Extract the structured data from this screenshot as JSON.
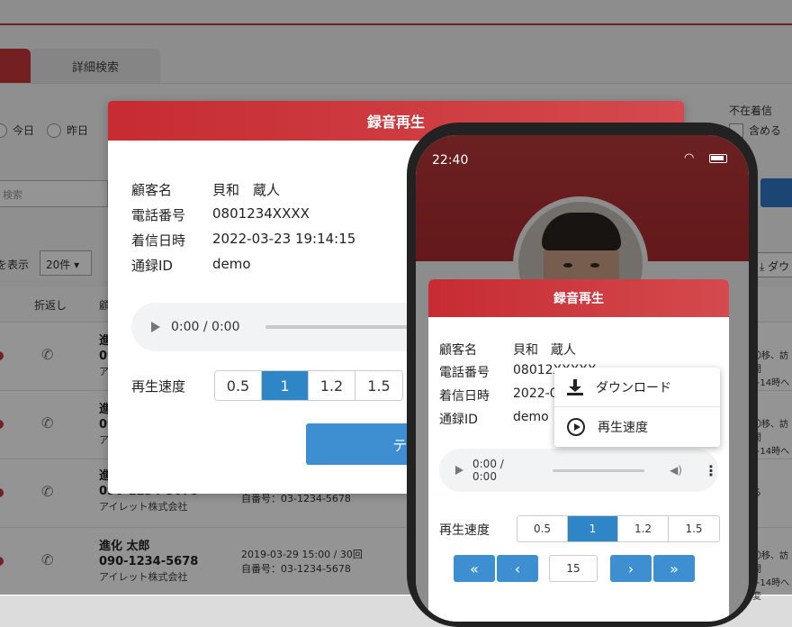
{
  "background": {
    "tab_advanced_search": "詳細検索",
    "radio_today": "今日",
    "radio_yesterday": "昨日",
    "keyword_placeholder": "検索",
    "missed_calls_label": "不在着信",
    "include_label": "含める",
    "show_label": "を表示",
    "count_select": "20件 ▾",
    "download_button": "⤓ ダウ",
    "col_callback": "折返し",
    "col_customer": "顧",
    "rows": [
      {
        "name": "進",
        "phone": "09",
        "company": "アイ",
        "info1": "",
        "info2": "",
        "side1": "〇移、訪問",
        "side2": "+14時へ変"
      },
      {
        "name": "進",
        "phone": "09",
        "company": "アイ",
        "info1": "",
        "info2": "",
        "side1": "〇移、訪問",
        "side2": "+14時へ変"
      },
      {
        "name": "進",
        "phone": "090-1234-5678",
        "company": "アイレット株式会社",
        "info1": "",
        "info2": "自番号：03-1234-5678",
        "side1": "る",
        "side2": ""
      },
      {
        "name": "進化 太郎",
        "phone": "090-1234-5678",
        "company": "アイレット株式会社",
        "info1": "2019-03-29 15:00 / 30回",
        "info2": "自番号：03-1234-5678",
        "side1": "〇移、訪問",
        "side2": "+14時へ変"
      }
    ]
  },
  "modal": {
    "title": "録音再生",
    "fields": [
      {
        "label": "顧客名",
        "value": "貝和　蔵人"
      },
      {
        "label": "電話番号",
        "value": "0801234XXXX"
      },
      {
        "label": "着信日時",
        "value": "2022-03-23 19:14:15"
      },
      {
        "label": "通録ID",
        "value": "demo"
      }
    ],
    "audio_time": "0:00 / 0:00",
    "speed_label": "再生速度",
    "speeds": [
      "0.5",
      "1",
      "1.2",
      "1.5"
    ],
    "speed_selected": "1",
    "text_button": "テキス"
  },
  "phone": {
    "time": "22:40",
    "modal_title": "録音再生",
    "fields": [
      {
        "label": "顧客名",
        "value": "貝和　蔵人"
      },
      {
        "label": "電話番号",
        "value": "08012XXXXX"
      },
      {
        "label": "着信日時",
        "value": "2022-0"
      },
      {
        "label": "通録ID",
        "value": "demo"
      }
    ],
    "audio_time": "0:00 / 0:00",
    "speed_label": "再生速度",
    "speeds": [
      "0.5",
      "1",
      "1.2",
      "1.5"
    ],
    "speed_selected": "1",
    "menu": [
      {
        "label": "ダウンロード",
        "icon": "download-icon"
      },
      {
        "label": "再生速度",
        "icon": "play-circle-icon"
      }
    ],
    "pager": {
      "first": "«",
      "prev": "‹",
      "page": "15",
      "next": "›",
      "last": "»"
    }
  },
  "colors": {
    "brand_red": "#c62c31",
    "accent_blue": "#2f86c6"
  }
}
